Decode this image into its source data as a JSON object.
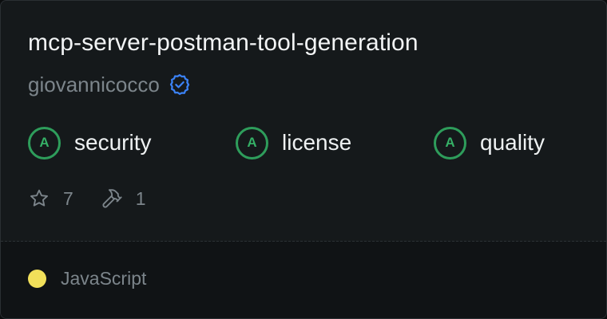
{
  "card": {
    "title": "mcp-server-postman-tool-generation",
    "author": "giovannicocco",
    "verified_icon": "verified-badge-icon",
    "scores": [
      {
        "grade": "A",
        "label": "security"
      },
      {
        "grade": "A",
        "label": "license"
      },
      {
        "grade": "A",
        "label": "quality"
      }
    ],
    "stats": {
      "stars": "7",
      "star_icon": "star-icon",
      "tools": "1",
      "tools_icon": "hammer-icon"
    },
    "language": {
      "name": "JavaScript",
      "color": "#f1e05a"
    }
  },
  "colors": {
    "background": "#15191b",
    "footer_background": "#101315",
    "grade_green": "#2e9d5b",
    "verified_blue": "#3b82f6"
  }
}
